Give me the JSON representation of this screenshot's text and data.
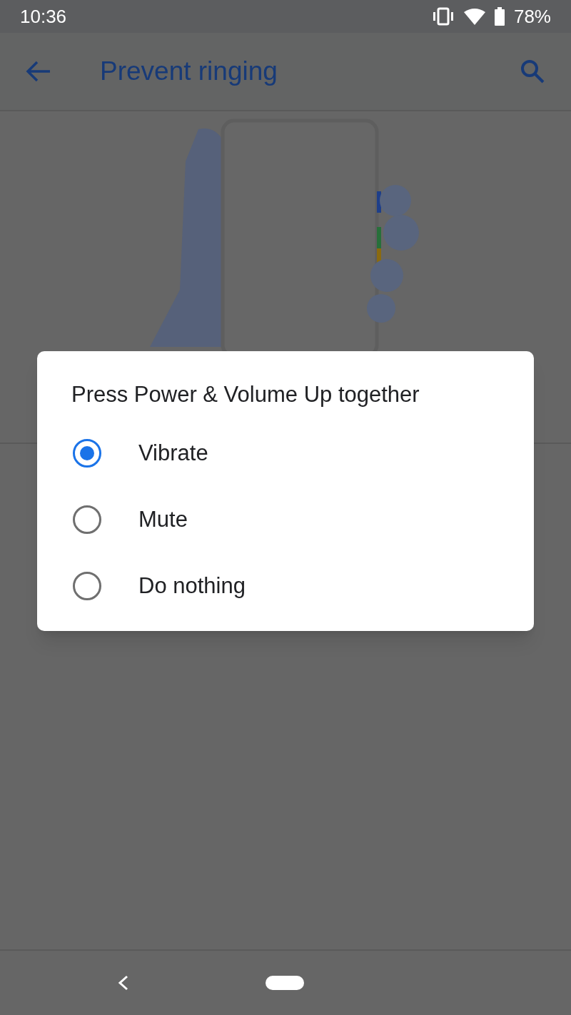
{
  "status_bar": {
    "time": "10:36",
    "battery": "78%"
  },
  "app_bar": {
    "title": "Prevent ringing"
  },
  "dialog": {
    "title": "Press Power & Volume Up together",
    "options": [
      {
        "label": "Vibrate",
        "selected": true
      },
      {
        "label": "Mute",
        "selected": false
      },
      {
        "label": "Do nothing",
        "selected": false
      }
    ]
  }
}
